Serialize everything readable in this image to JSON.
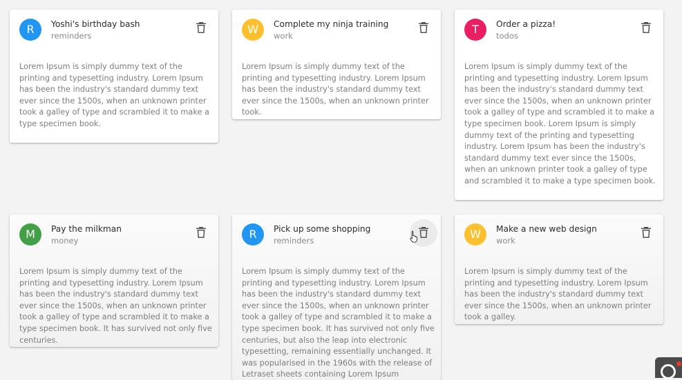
{
  "notes": [
    {
      "title": "Yoshi's birthday bash",
      "category": "reminders",
      "initial": "R",
      "avatar_color": "#2196f3",
      "body": "Lorem Ipsum is simply dummy text of the printing and typesetting industry. Lorem Ipsum has been the industry's standard dummy text ever since the 1500s, when an unknown printer took a galley of type and scrambled it to make a type specimen book."
    },
    {
      "title": "Complete my ninja training",
      "category": "work",
      "initial": "W",
      "avatar_color": "#fbc02d",
      "body": "Lorem Ipsum is simply dummy text of the printing and typesetting industry. Lorem Ipsum has been the industry's standard dummy text ever since the 1500s, when an unknown printer took."
    },
    {
      "title": "Order a pizza!",
      "category": "todos",
      "initial": "T",
      "avatar_color": "#e91e63",
      "body": "Lorem Ipsum is simply dummy text of the printing and typesetting industry. Lorem Ipsum has been the industry's standard dummy text ever since the 1500s, when an unknown printer took a galley of type and scrambled it to make a type specimen book. Lorem Ipsum is simply dummy text of the printing and typesetting industry. Lorem Ipsum has been the industry's standard dummy text ever since the 1500s, when an unknown printer took a galley of type and scrambled it to make a type specimen book."
    },
    {
      "title": "Pay the milkman",
      "category": "money",
      "initial": "M",
      "avatar_color": "#43a047",
      "body": "Lorem Ipsum is simply dummy text of the printing and typesetting industry. Lorem Ipsum has been the industry's standard dummy text ever since the 1500s, when an unknown printer took a galley of type and scrambled it to make a type specimen book. It has survived not only five centuries."
    },
    {
      "title": "Pick up some shopping",
      "category": "reminders",
      "initial": "R",
      "avatar_color": "#2196f3",
      "body": "Lorem Ipsum is simply dummy text of the printing and typesetting industry. Lorem Ipsum has been the industry's standard dummy text ever since the 1500s, when an unknown printer took a galley of type and scrambled it to make a type specimen book. It has survived not only five centuries, but also the leap into electronic typesetting, remaining essentially unchanged. It was popularised in the 1960s with the release of Letraset sheets containing Lorem Ipsum"
    },
    {
      "title": "Make a new web design",
      "category": "work",
      "initial": "W",
      "avatar_color": "#fbc02d",
      "body": "Lorem Ipsum is simply dummy text of the printing and typesetting industry. Lorem Ipsum has been the industry's standard dummy text ever since the 1500s, when an unknown printer took a galley."
    }
  ],
  "icons": {
    "delete": "trash-icon",
    "cursor": "hand-pointer-icon"
  }
}
